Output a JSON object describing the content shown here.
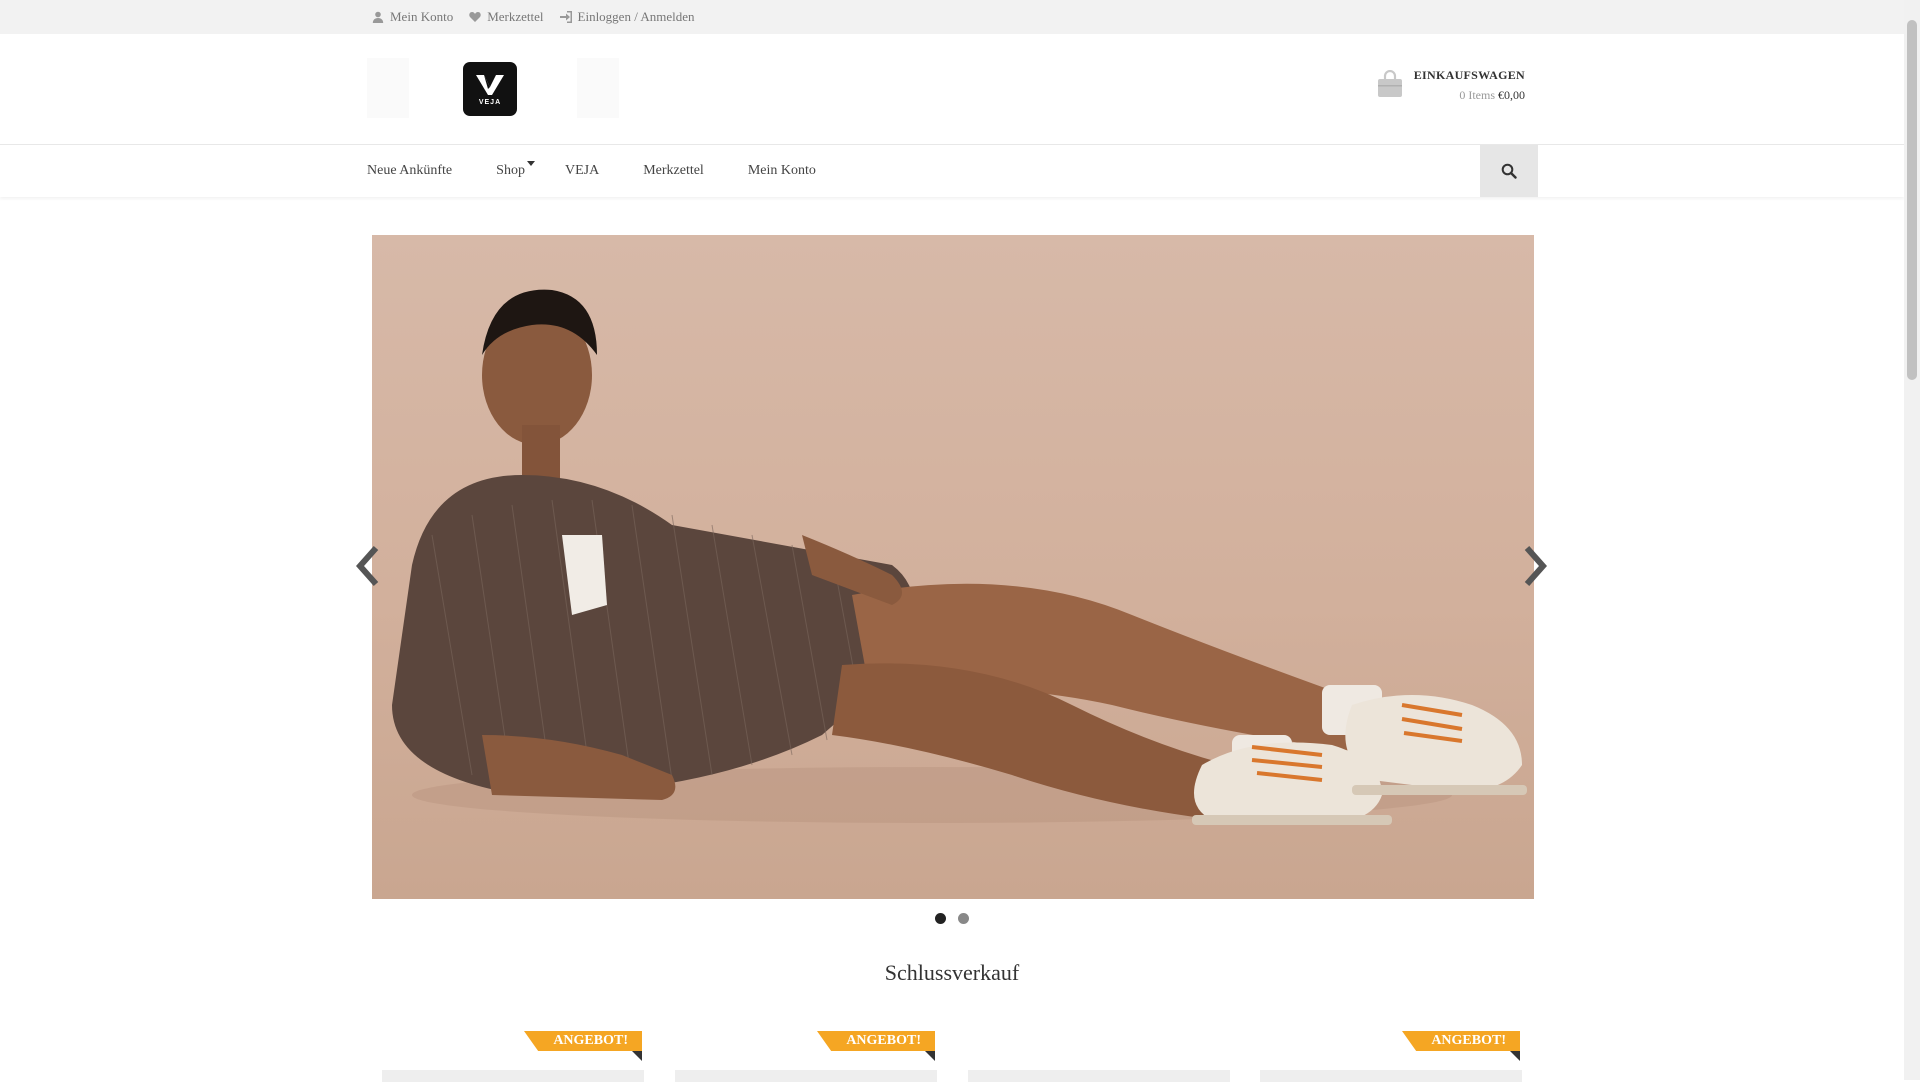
{
  "topbar": {
    "my_account": "Mein Konto",
    "wishlist": "Merkzettel",
    "login": "Einloggen / Anmelden"
  },
  "header": {
    "logo_text": "VEJA",
    "cart": {
      "title": "EINKAUFSWAGEN",
      "items": "0 Items",
      "total": "€0,00"
    }
  },
  "nav": {
    "items": [
      {
        "label": "Neue Ankünfte"
      },
      {
        "label": "Shop"
      },
      {
        "label": "VEJA"
      },
      {
        "label": "Merkzettel"
      },
      {
        "label": "Mein Konto"
      }
    ]
  },
  "slider": {
    "slide_count": 2,
    "active_slide": 1
  },
  "section": {
    "title": "Schlussverkauf"
  },
  "products": [
    {
      "badge": "ANGEBOT!"
    },
    {
      "badge": "ANGEBOT!"
    },
    {
      "badge": ""
    },
    {
      "badge": "ANGEBOT!"
    }
  ],
  "colors": {
    "badge": "#f5a623",
    "topbar": "#f2f2f2",
    "slide_background": "#d6b8a6"
  }
}
